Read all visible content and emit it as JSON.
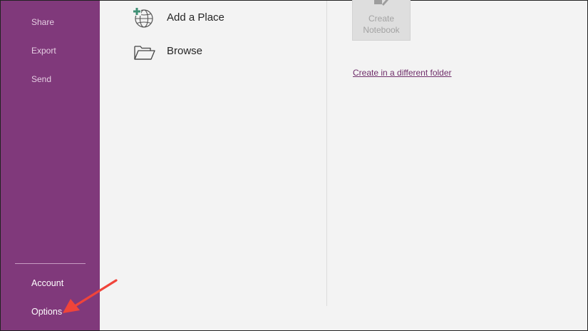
{
  "sidebar": {
    "top_items": [
      {
        "label": "Share"
      },
      {
        "label": "Export"
      },
      {
        "label": "Send"
      }
    ],
    "bottom_items": [
      {
        "label": "Account"
      },
      {
        "label": "Options"
      }
    ]
  },
  "places": [
    {
      "label": "Add a Place",
      "icon": "globe-plus-icon"
    },
    {
      "label": "Browse",
      "icon": "folder-icon"
    }
  ],
  "create": {
    "button_label": "Create Notebook",
    "different_folder_link": "Create in a different folder"
  },
  "colors": {
    "sidebar": "#80397b",
    "accent_link": "#6f2e6a",
    "arrow": "#f0443a",
    "plus": "#3f8f74"
  }
}
